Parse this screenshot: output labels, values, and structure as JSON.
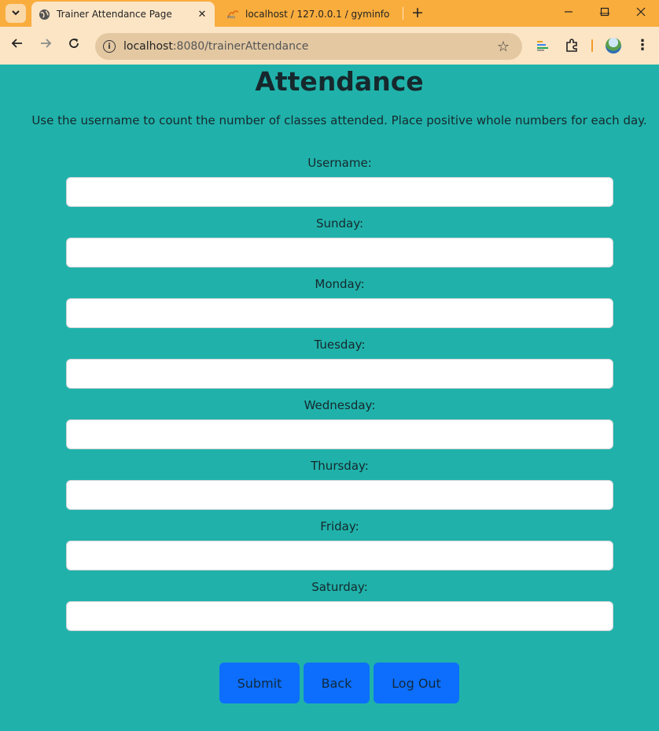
{
  "browser": {
    "tabs": [
      {
        "title": "Trainer Attendance Page",
        "active": true,
        "icon": "globe-icon"
      },
      {
        "title": "localhost / 127.0.0.1 / gyminfo",
        "active": false,
        "icon": "phpmyadmin-icon"
      }
    ],
    "address": {
      "host": "localhost",
      "path": ":8080/trainerAttendance"
    }
  },
  "page": {
    "heading": "Attendance",
    "instructions": "Use the username to count the number of classes attended. Place positive whole numbers for each day.",
    "fields": [
      {
        "label": "Username:",
        "value": ""
      },
      {
        "label": "Sunday:",
        "value": ""
      },
      {
        "label": "Monday:",
        "value": ""
      },
      {
        "label": "Tuesday:",
        "value": ""
      },
      {
        "label": "Wednesday:",
        "value": ""
      },
      {
        "label": "Thursday:",
        "value": ""
      },
      {
        "label": "Friday:",
        "value": ""
      },
      {
        "label": "Saturday:",
        "value": ""
      }
    ],
    "buttons": {
      "submit": "Submit",
      "back": "Back",
      "logout": "Log Out"
    }
  },
  "colors": {
    "page_bg": "#20b2aa",
    "button_bg": "#0d6efd",
    "tabbar_bg": "#f9ad3d",
    "toolbar_bg": "#fce5c5"
  }
}
